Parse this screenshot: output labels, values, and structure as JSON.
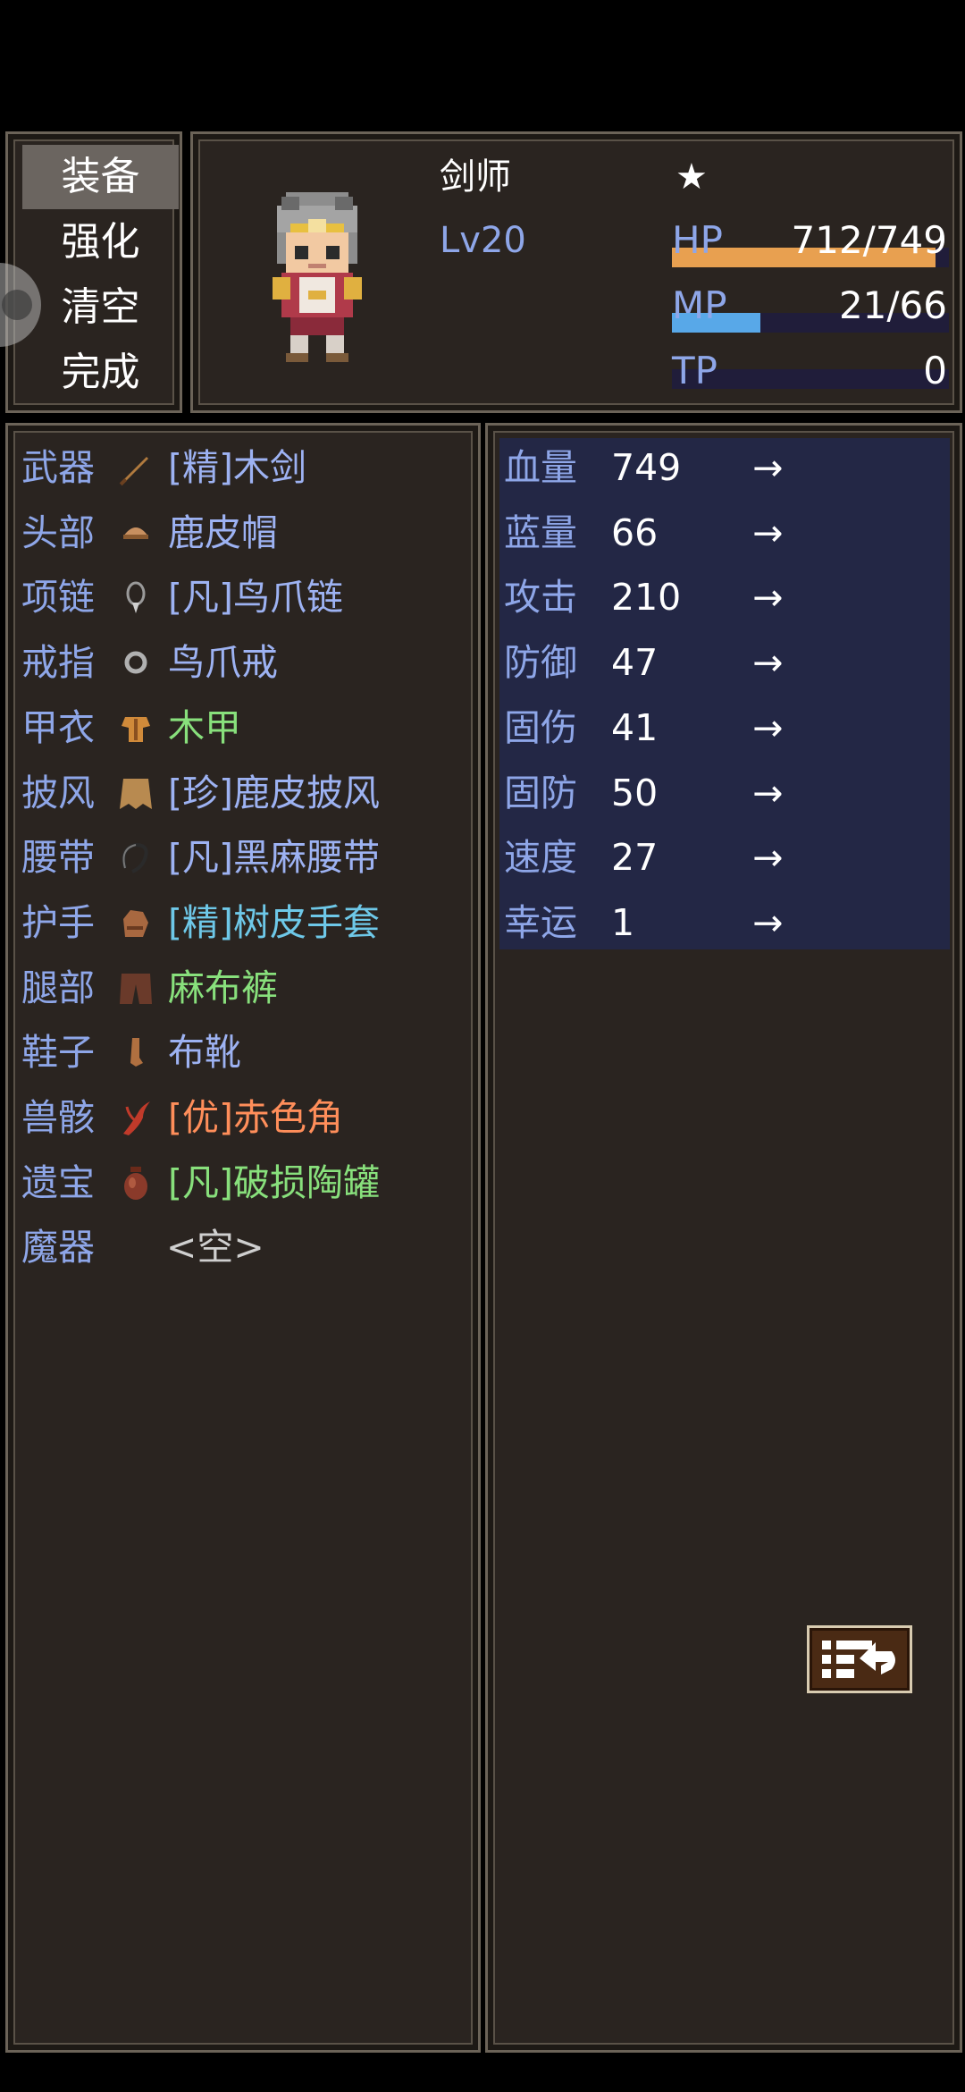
{
  "menu": {
    "items": [
      {
        "label": "装备",
        "selected": true
      },
      {
        "label": "强化",
        "selected": false
      },
      {
        "label": "清空",
        "selected": false
      },
      {
        "label": "完成",
        "selected": false
      }
    ]
  },
  "status": {
    "class_name": "剑师",
    "star": "★",
    "level": "Lv20",
    "hp": {
      "label": "HP",
      "value": "712/749",
      "current": 712,
      "max": 749,
      "color": "#e8a050"
    },
    "mp": {
      "label": "MP",
      "value": "21/66",
      "current": 21,
      "max": 66,
      "color": "#58a8e8"
    },
    "tp": {
      "label": "TP",
      "value": "0",
      "current": 0,
      "max": 100,
      "color": "#60c060"
    }
  },
  "equipment": [
    {
      "slot": "武器",
      "name": "[精]木剑",
      "icon": "wooden-sword-icon",
      "color": "#9db2f2"
    },
    {
      "slot": "头部",
      "name": "鹿皮帽",
      "icon": "leather-cap-icon",
      "color": "#9db2f2"
    },
    {
      "slot": "项链",
      "name": "[凡]鸟爪链",
      "icon": "claw-necklace-icon",
      "color": "#9db2f2"
    },
    {
      "slot": "戒指",
      "name": "鸟爪戒",
      "icon": "ring-icon",
      "color": "#9db2f2"
    },
    {
      "slot": "甲衣",
      "name": "木甲",
      "icon": "armor-icon",
      "color": "#88e07c"
    },
    {
      "slot": "披风",
      "name": "[珍]鹿皮披风",
      "icon": "cape-icon",
      "color": "#9db2f2"
    },
    {
      "slot": "腰带",
      "name": "[凡]黑麻腰带",
      "icon": "belt-icon",
      "color": "#9db2f2"
    },
    {
      "slot": "护手",
      "name": "[精]树皮手套",
      "icon": "gloves-icon",
      "color": "#6ec8e8"
    },
    {
      "slot": "腿部",
      "name": "麻布裤",
      "icon": "pants-icon",
      "color": "#88e07c"
    },
    {
      "slot": "鞋子",
      "name": "布靴",
      "icon": "boots-icon",
      "color": "#9db2f2"
    },
    {
      "slot": "兽骸",
      "name": "[优]赤色角",
      "icon": "red-horn-icon",
      "color": "#ff8e5a"
    },
    {
      "slot": "遗宝",
      "name": "[凡]破损陶罐",
      "icon": "clay-pot-icon",
      "color": "#88e07c"
    },
    {
      "slot": "魔器",
      "name": "<空>",
      "icon": "",
      "color": "#cfcfcf"
    }
  ],
  "stats": [
    {
      "label": "血量",
      "value": "749",
      "arrow": "→"
    },
    {
      "label": "蓝量",
      "value": "66",
      "arrow": "→"
    },
    {
      "label": "攻击",
      "value": "210",
      "arrow": "→"
    },
    {
      "label": "防御",
      "value": "47",
      "arrow": "→"
    },
    {
      "label": "固伤",
      "value": "41",
      "arrow": "→"
    },
    {
      "label": "固防",
      "value": "50",
      "arrow": "→"
    },
    {
      "label": "速度",
      "value": "27",
      "arrow": "→"
    },
    {
      "label": "幸运",
      "value": "1",
      "arrow": "→"
    }
  ],
  "actions": {
    "swap_icon": "page-switch-icon"
  }
}
